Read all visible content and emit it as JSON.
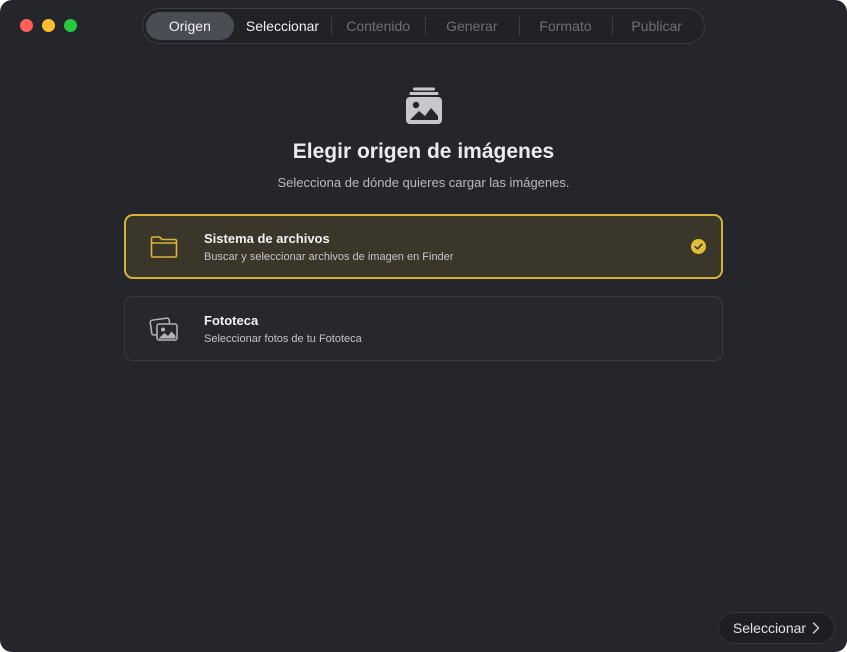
{
  "window": {
    "controls": [
      "close",
      "minimize",
      "zoom"
    ]
  },
  "steps": [
    {
      "label": "Origen",
      "state": "active"
    },
    {
      "label": "Seleccionar",
      "state": "enabled"
    },
    {
      "label": "Contenido",
      "state": "disabled"
    },
    {
      "label": "Generar",
      "state": "disabled"
    },
    {
      "label": "Formato",
      "state": "disabled"
    },
    {
      "label": "Publicar",
      "state": "disabled"
    }
  ],
  "header": {
    "icon": "photo-stack-icon",
    "title": "Elegir origen de imágenes",
    "subtitle": "Selecciona de dónde quieres cargar las imágenes."
  },
  "options": [
    {
      "icon": "folder-icon",
      "title": "Sistema de archivos",
      "description": "Buscar y seleccionar archivos de imagen en Finder",
      "selected": true
    },
    {
      "icon": "photos-icon",
      "title": "Fototeca",
      "description": "Seleccionar fotos de tu Fototeca",
      "selected": false
    }
  ],
  "footer": {
    "next_label": "Seleccionar",
    "next_icon": "chevron-right-icon"
  },
  "colors": {
    "background": "#24262b",
    "accent": "#d6b238",
    "selected_card": "#3a362a"
  }
}
